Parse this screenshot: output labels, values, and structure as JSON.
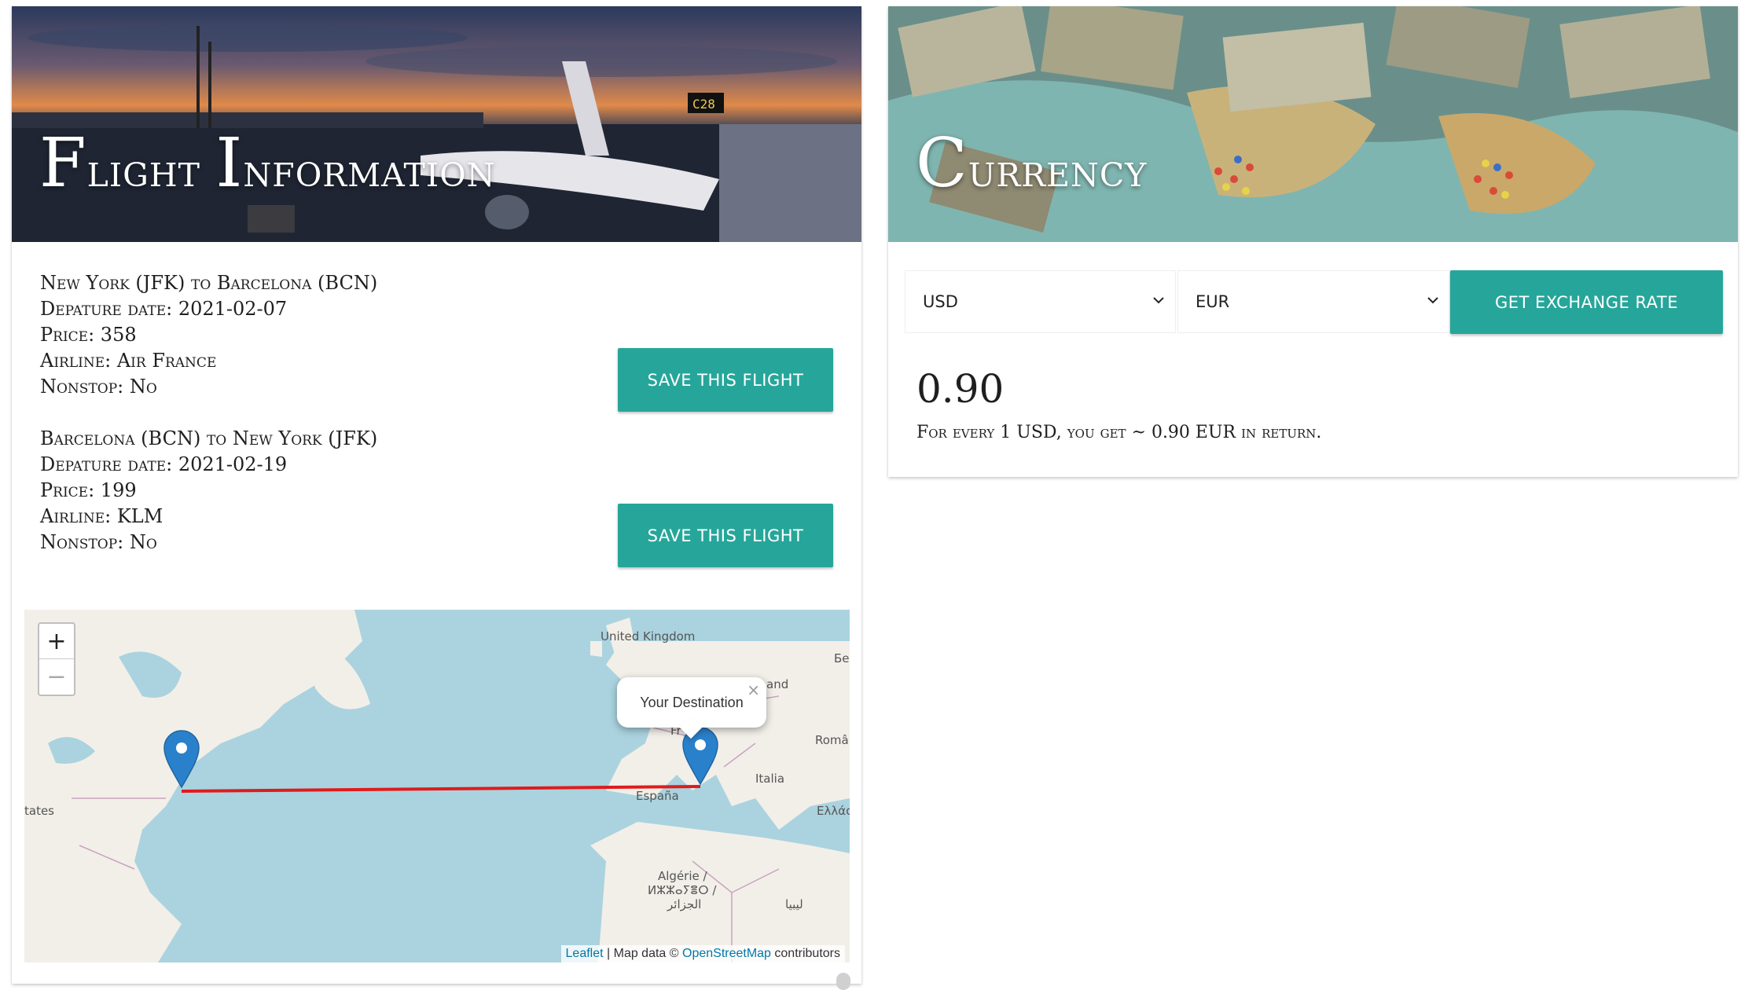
{
  "flight": {
    "title": "Flight Information",
    "flights": [
      {
        "route": "New York (JFK) to Barcelona (BCN)",
        "date": "Depature date: 2021-02-07",
        "price": "Price: 358",
        "airline": "Airline: Air France",
        "nonstop": "Nonstop: No",
        "save_label": "Save this flight"
      },
      {
        "route": "Barcelona (BCN) to New York (JFK)",
        "date": "Depature date: 2021-02-19",
        "price": "Price: 199",
        "airline": "Airline: KLM",
        "nonstop": "Nonstop: No",
        "save_label": "Save this flight"
      }
    ],
    "map": {
      "zoom_in": "+",
      "zoom_out": "−",
      "popup_text": "Your Destination",
      "popup_close": "×",
      "attribution_leaflet": "Leaflet",
      "attribution_sep": " | Map data © ",
      "attribution_osm": "OpenStreetMap",
      "attribution_tail": " contributors",
      "labels": {
        "uk": "United Kingdom",
        "be": "Бе",
        "land": "and",
        "france": "Fr",
        "romania": "Româ",
        "italia": "Italia",
        "espana": "España",
        "greece": "Ελλάς",
        "states": "tates",
        "algeria1": "Algérie /",
        "algeria2": "ⵍⵣⵣⴰⵢⴻⵔ /",
        "algeria3": "الجزائر",
        "libya": "ليبيا"
      },
      "route_color": "#e01b1b",
      "marker_color": "#2a81cb"
    }
  },
  "currency": {
    "title": "Currency",
    "from": "USD",
    "to": "EUR",
    "button_label": "Get exchange rate",
    "rate": "0.90",
    "description": "For every 1 USD, you get ~ 0.90 EUR in return."
  },
  "colors": {
    "accent": "#26a69a"
  }
}
